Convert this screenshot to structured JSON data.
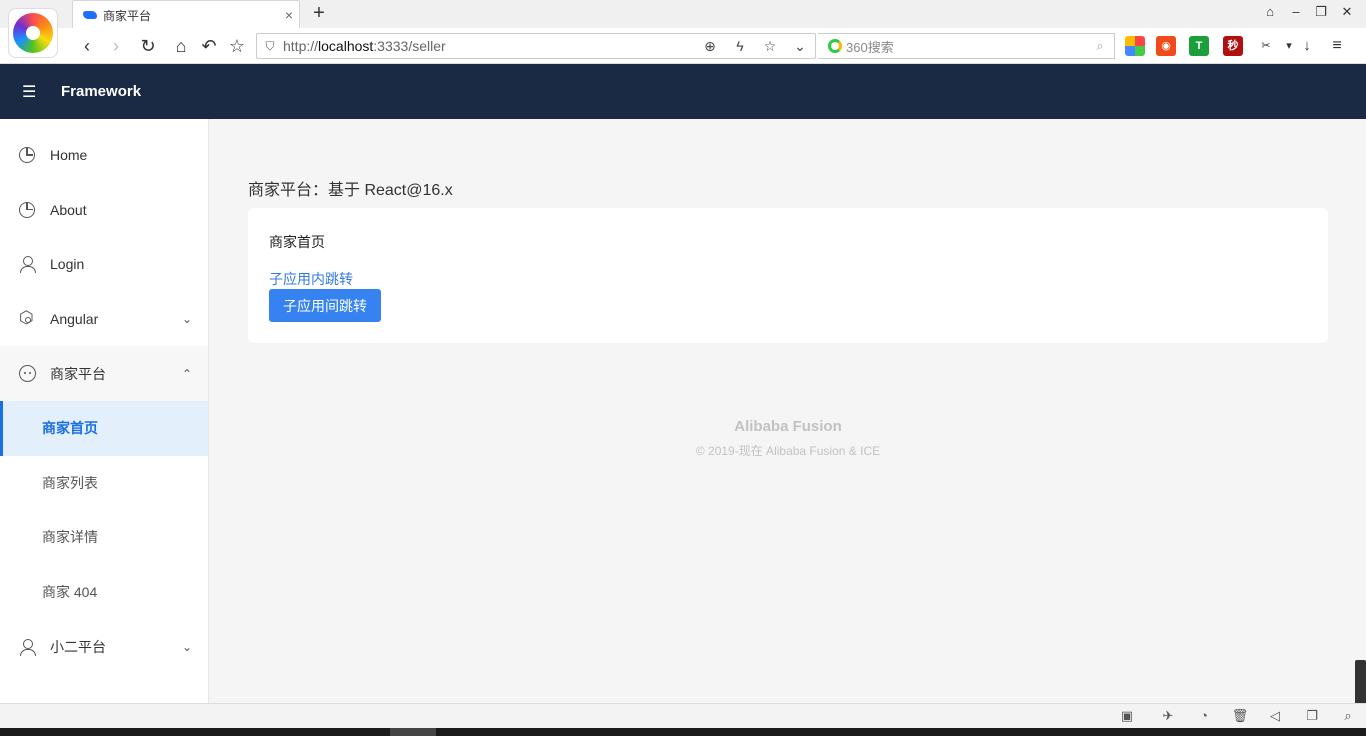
{
  "browser": {
    "tab_title": "商家平台",
    "tab_close": "×",
    "new_tab": "+",
    "url_scheme": "http://",
    "url_host": "localhost",
    "url_rest": ":3333/seller",
    "search_placeholder": "360搜索",
    "ext_seconds_label": "秒"
  },
  "header": {
    "brand": "Framework"
  },
  "sidebar": {
    "items": [
      {
        "label": "Home"
      },
      {
        "label": "About"
      },
      {
        "label": "Login"
      },
      {
        "label": "Angular"
      },
      {
        "label": "商家平台"
      },
      {
        "label": "小二平台"
      }
    ],
    "submenu": [
      {
        "label": "商家首页"
      },
      {
        "label": "商家列表"
      },
      {
        "label": "商家详情"
      },
      {
        "label": "商家 404"
      }
    ]
  },
  "main": {
    "page_title": "商家平台：基于 React@16.x",
    "card_heading": "商家首页",
    "inner_link": "子应用内跳转",
    "cross_button": "子应用间跳转"
  },
  "footer": {
    "title": "Alibaba Fusion",
    "copyright": "© 2019-现在 Alibaba Fusion & ICE"
  },
  "colors": {
    "header_bg": "#1a2a44",
    "accent": "#3582f0",
    "active_bg": "#e3f0fc"
  }
}
